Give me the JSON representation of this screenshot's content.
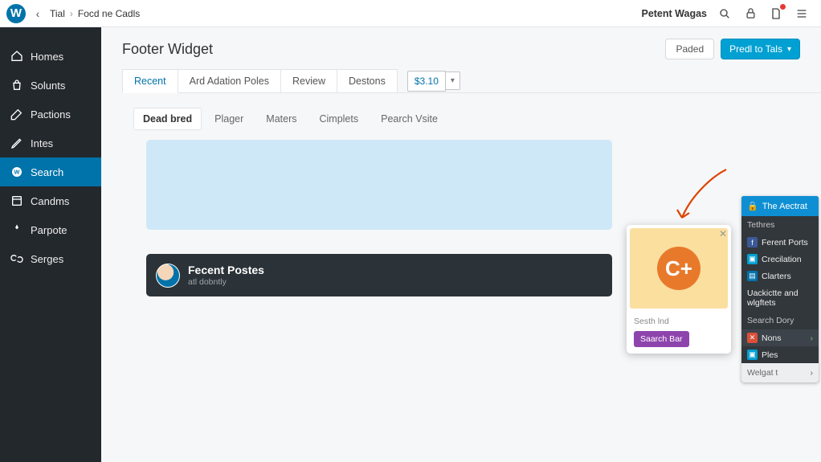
{
  "topbar": {
    "logo_letter": "W",
    "crumb1": "Tial",
    "crumb2": "Focd ne Cadls",
    "right_label": "Petent Wagas"
  },
  "sidebar": {
    "items": [
      {
        "label": "Homes"
      },
      {
        "label": "Solunts"
      },
      {
        "label": "Pactions"
      },
      {
        "label": "Intes"
      },
      {
        "label": "Search"
      },
      {
        "label": "Candms"
      },
      {
        "label": "Parpote"
      },
      {
        "label": "Serges"
      }
    ]
  },
  "header": {
    "title": "Footer Widget",
    "pill": "Paded",
    "blue": "Predl to Tals"
  },
  "tabs1": {
    "items": [
      {
        "label": "Recent"
      },
      {
        "label": "Ard Adation Poles"
      },
      {
        "label": "Review"
      },
      {
        "label": "Destons"
      }
    ],
    "select_value": "$3.10"
  },
  "tabs2": {
    "items": [
      {
        "label": "Dead bred"
      },
      {
        "label": "Plager"
      },
      {
        "label": "Maters"
      },
      {
        "label": "Cimplets"
      },
      {
        "label": "Pearch Vsite"
      }
    ]
  },
  "widget": {
    "title": "Fecent Postes",
    "subtitle": "atl dobntly"
  },
  "popup": {
    "logo": "C+",
    "caption": "Sesth lnd",
    "button": "Saarch Bar"
  },
  "wpanel": {
    "head": "The Aectrat",
    "sections": {
      "top_label": "Tethres",
      "rows1": [
        {
          "label": "Ferent Ports"
        },
        {
          "label": "Crecilation"
        },
        {
          "label": "Clarters"
        }
      ],
      "multiline": "Uackictte and wlgftets",
      "sec2_label": "Search Dory",
      "rows2": [
        {
          "label": "Nons"
        },
        {
          "label": "Ples"
        }
      ],
      "footer": "Welgat t"
    }
  }
}
